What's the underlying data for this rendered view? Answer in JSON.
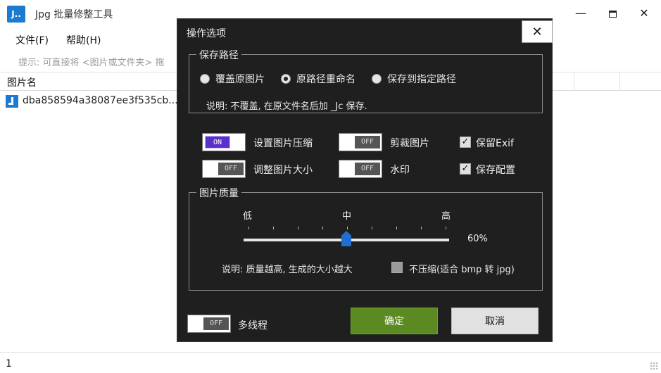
{
  "window": {
    "logo_text": "J..",
    "title": "Jpg 批量修整工具",
    "min_glyph": "—",
    "close_glyph": "✕"
  },
  "menu": {
    "file": "文件(F)",
    "help": "帮助(H)"
  },
  "hint": "提示: 可直接将 <图片或文件夹> 拖",
  "table": {
    "header_name": "图片名",
    "rows": [
      {
        "name": "dba858594a38087ee3f535cb..."
      }
    ]
  },
  "status": {
    "count": "1"
  },
  "dialog": {
    "title": "操作选项",
    "close_glyph": "✕",
    "save_path": {
      "legend": "保存路径",
      "options": [
        "覆盖原图片",
        "原路径重命名",
        "保存到指定路径"
      ],
      "selected_index": 1,
      "description": "说明: 不覆盖, 在原文件名后加 _Jc 保存."
    },
    "options": {
      "compress": {
        "label": "设置图片压缩",
        "state": "ON"
      },
      "crop": {
        "label": "剪裁图片",
        "state": "OFF"
      },
      "keep_exif": {
        "label": "保留Exif",
        "checked": true
      },
      "resize": {
        "label": "调整图片大小",
        "state": "OFF"
      },
      "watermark": {
        "label": "水印",
        "state": "OFF"
      },
      "save_config": {
        "label": "保存配置",
        "checked": true
      }
    },
    "quality": {
      "legend": "图片质量",
      "low": "低",
      "mid": "中",
      "high": "高",
      "value": 60,
      "value_text": "60%",
      "description": "说明: 质量越高, 生成的大小越大",
      "no_compress_label": "不压缩(适合 bmp 转 jpg)",
      "no_compress_checked": false
    },
    "multithread": {
      "label": "多线程",
      "state": "OFF"
    },
    "ok_label": "确定",
    "cancel_label": "取消"
  },
  "colors": {
    "dialog_bg": "#1f1f1f",
    "toggle_on": "#5b2fc9",
    "ok_button": "#5c8a22",
    "slider_thumb": "#1e6fd0",
    "logo": "#1c7ad1"
  }
}
